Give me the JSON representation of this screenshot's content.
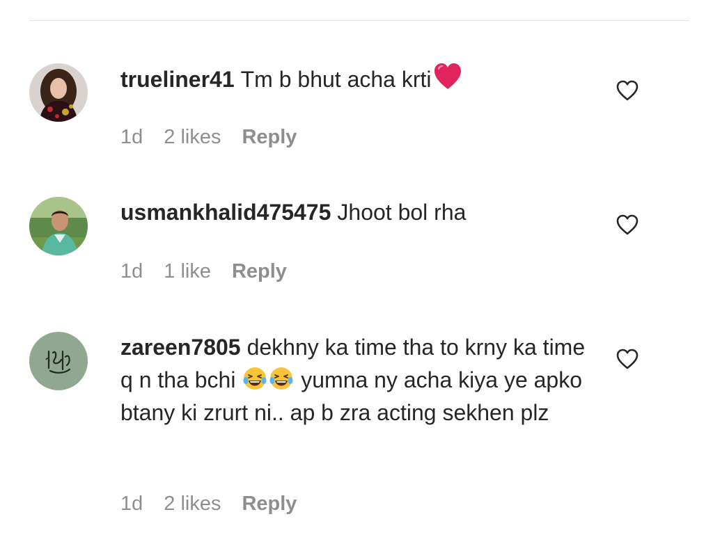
{
  "comments": [
    {
      "username": "trueliner41",
      "text": "Tm b bhut acha krti",
      "emoji_icon": "red-heart-icon",
      "time": "1d",
      "likes": "2 likes",
      "reply_label": "Reply"
    },
    {
      "username": "usmankhalid475475",
      "text": "Jhoot bol rha",
      "time": "1d",
      "likes": "1 like",
      "reply_label": "Reply"
    },
    {
      "username": "zareen7805",
      "text_before": "dekhny ka time tha to krny ka time q n tha bchi",
      "emoji_icon": "laughing-tears-icon",
      "text_after": "yumna ny acha kiya ye apko btany ki zrurt ni.. ap b zra acting sekhen plz",
      "time": "1d",
      "likes": "2 likes",
      "reply_label": "Reply"
    }
  ],
  "colors": {
    "text": "#262626",
    "meta": "#8e8e8e",
    "divider": "#e6e6e6",
    "heart_emoji": "#e0245e",
    "avatar3_bg": "#8fa88f"
  }
}
